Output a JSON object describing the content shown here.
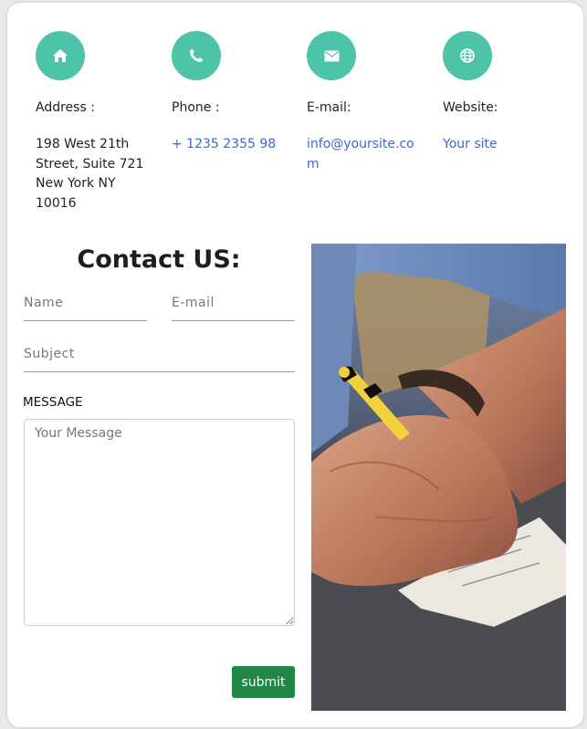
{
  "info": [
    {
      "icon": "home-icon",
      "label": "Address :",
      "lines": [
        "198 West 21th",
        "Street, Suite 721",
        "New York NY",
        "10016"
      ],
      "is_link": false
    },
    {
      "icon": "phone-icon",
      "label": "Phone :",
      "lines": [
        "+ 1235 2355 98"
      ],
      "is_link": true
    },
    {
      "icon": "envelope-icon",
      "label": "E-mail:",
      "lines": [
        "info@yoursite.co",
        "m"
      ],
      "is_link": true
    },
    {
      "icon": "globe-icon",
      "label": "Website:",
      "lines": [
        "Your site"
      ],
      "is_link": true
    }
  ],
  "contact": {
    "title": "Contact US:",
    "name_placeholder": "Name",
    "email_placeholder": "E-mail",
    "subject_placeholder": "Subject",
    "message_label": "MESSAGE",
    "message_placeholder": "Your Message",
    "submit_label": "submit"
  },
  "colors": {
    "accent": "#4dc4a8",
    "link": "#3a66d6",
    "submit": "#218746"
  },
  "photo_icon": "hand-writing-photo"
}
